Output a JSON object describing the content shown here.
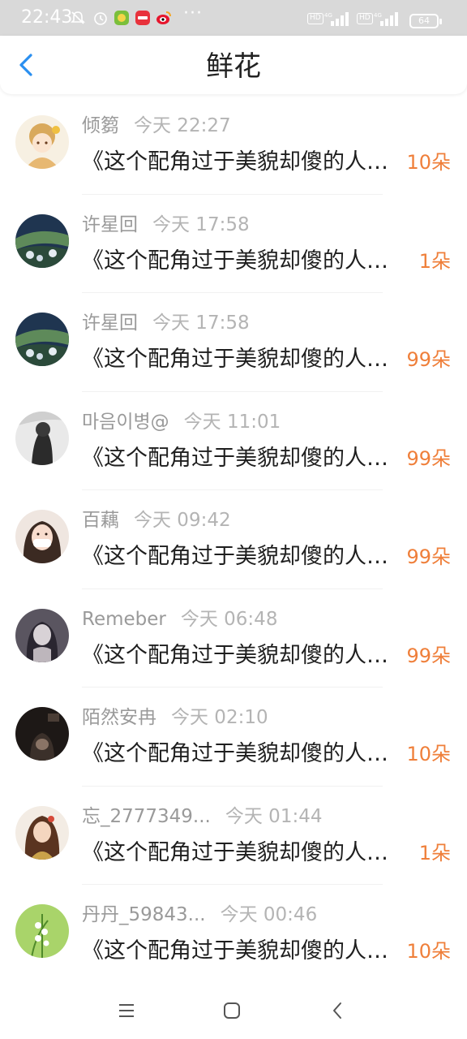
{
  "status_bar": {
    "time": "22:43",
    "icons": [
      "mute-icon",
      "alarm-icon",
      "app-icon-green",
      "app-icon-red",
      "weibo-icon"
    ],
    "more": "···",
    "net1": "HD",
    "net2": "HD",
    "battery": "64"
  },
  "header": {
    "title": "鲜花",
    "back_icon": "back-chevron-icon"
  },
  "accent_color": "#ef7f3a",
  "items": [
    {
      "name": "倾篘",
      "time": "今天 22:27",
      "content": "《这个配角过于美貌却傻的人设》",
      "count": "10朵"
    },
    {
      "name": "许星回",
      "time": "今天 17:58",
      "content": "《这个配角过于美貌却傻的人设》",
      "count": "1朵"
    },
    {
      "name": "许星回",
      "time": "今天 17:58",
      "content": "《这个配角过于美貌却傻的人设》",
      "count": "99朵"
    },
    {
      "name": "마음이병@",
      "time": "今天 11:01",
      "content": "《这个配角过于美貌却傻的人设》",
      "count": "99朵"
    },
    {
      "name": "百藕",
      "time": "今天 09:42",
      "content": "《这个配角过于美貌却傻的人设》",
      "count": "99朵"
    },
    {
      "name": "Remeber",
      "time": "今天 06:48",
      "content": "《这个配角过于美貌却傻的人设》",
      "count": "99朵"
    },
    {
      "name": "陌然安冉",
      "time": "今天 02:10",
      "content": "《这个配角过于美貌却傻的人设》",
      "count": "10朵"
    },
    {
      "name": "忘_2777349...",
      "time": "今天 01:44",
      "content": "《这个配角过于美貌却傻的人设》",
      "count": "1朵"
    },
    {
      "name": "丹丹_59843...",
      "time": "今天 00:46",
      "content": "《这个配角过于美貌却傻的人设》",
      "count": "10朵"
    }
  ],
  "system_nav": {
    "menu_icon": "menu-icon",
    "home_icon": "home-icon",
    "back_icon": "back-icon"
  }
}
